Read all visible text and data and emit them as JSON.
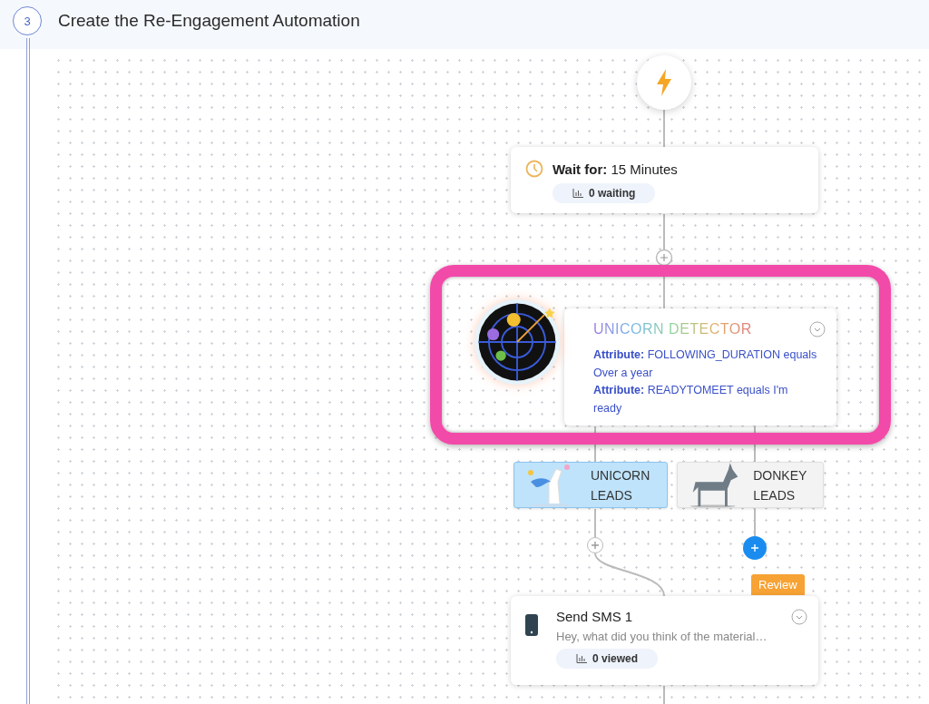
{
  "step": {
    "number": "3",
    "title": "Create the Re-Engagement Automation"
  },
  "wait": {
    "label": "Wait for:",
    "value": "15 Minutes",
    "stat": "0 waiting"
  },
  "detector": {
    "title": "UNICORN DETECTOR",
    "highlighted": true,
    "conditions": [
      {
        "label": "Attribute:",
        "text": "FOLLOWING_DURATION equals Over a year"
      },
      {
        "label": "Attribute:",
        "text": "READYTOMEET equals I'm ready"
      }
    ]
  },
  "branches": [
    {
      "kind": "unicorn",
      "label": "UNICORN LEADS",
      "selected": true,
      "add_active": false
    },
    {
      "kind": "donkey",
      "label": "DONKEY LEADS",
      "selected": false,
      "add_active": true
    }
  ],
  "sms": {
    "badge": "Review",
    "title": "Send SMS 1",
    "preview": "Hey, what did you think of the material…",
    "stat": "0 viewed"
  }
}
